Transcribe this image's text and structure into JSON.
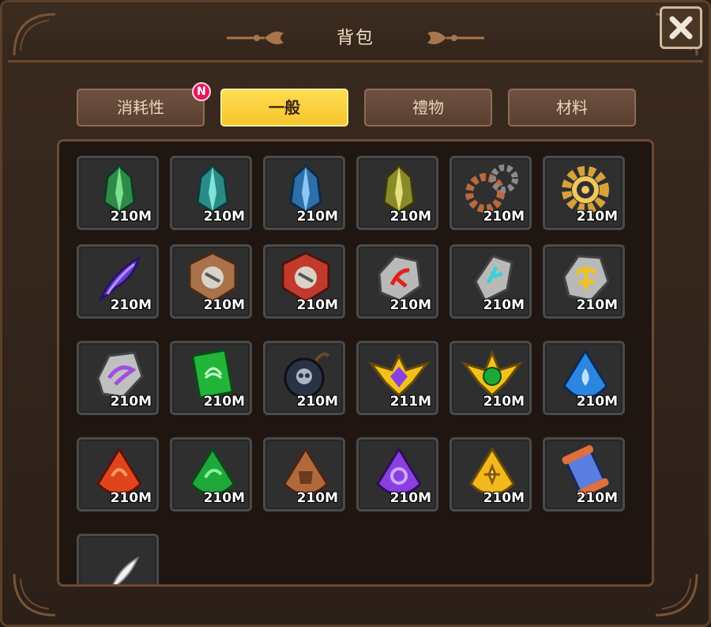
{
  "header": {
    "title": "背包"
  },
  "tabs": [
    {
      "label": "消耗性",
      "badge": "N",
      "active": false
    },
    {
      "label": "一般",
      "badge": "",
      "active": true
    },
    {
      "label": "禮物",
      "badge": "",
      "active": false
    },
    {
      "label": "材料",
      "badge": "",
      "active": false
    }
  ],
  "items": [
    {
      "icon": "green-crystal-icon",
      "count": "210M"
    },
    {
      "icon": "teal-crystal-icon",
      "count": "210M"
    },
    {
      "icon": "blue-crystal-icon",
      "count": "210M"
    },
    {
      "icon": "yellow-crystal-icon",
      "count": "210M"
    },
    {
      "icon": "bronze-gears-icon",
      "count": "210M"
    },
    {
      "icon": "gold-gear-icon",
      "count": "210M"
    },
    {
      "icon": "purple-claw-icon",
      "count": "210M"
    },
    {
      "icon": "bronze-emblem-icon",
      "count": "210M"
    },
    {
      "icon": "red-emblem-icon",
      "count": "210M"
    },
    {
      "icon": "red-rune-stone-icon",
      "count": "210M"
    },
    {
      "icon": "cyan-rune-stone-icon",
      "count": "210M"
    },
    {
      "icon": "gold-rune-stone-icon",
      "count": "210M"
    },
    {
      "icon": "purple-rune-stone-icon",
      "count": "210M"
    },
    {
      "icon": "green-winged-book-icon",
      "count": "210M"
    },
    {
      "icon": "skull-bomb-icon",
      "count": "210M"
    },
    {
      "icon": "purple-winged-gem-icon",
      "count": "211M"
    },
    {
      "icon": "green-winged-gem-icon",
      "count": "210M"
    },
    {
      "icon": "blue-water-shard-icon",
      "count": "210M"
    },
    {
      "icon": "red-shard-icon",
      "count": "210M"
    },
    {
      "icon": "green-shard-icon",
      "count": "210M"
    },
    {
      "icon": "brown-shard-icon",
      "count": "210M"
    },
    {
      "icon": "purple-shard-icon",
      "count": "210M"
    },
    {
      "icon": "yellow-shard-icon",
      "count": "210M"
    },
    {
      "icon": "blue-scroll-icon",
      "count": "210M"
    },
    {
      "icon": "white-feather-icon",
      "count": ""
    }
  ],
  "colors": {
    "tab_active": "#f6c52c",
    "tab_inactive": "#5a3f31",
    "badge": "#e8175d",
    "slot_bg": "#2f2f30"
  }
}
